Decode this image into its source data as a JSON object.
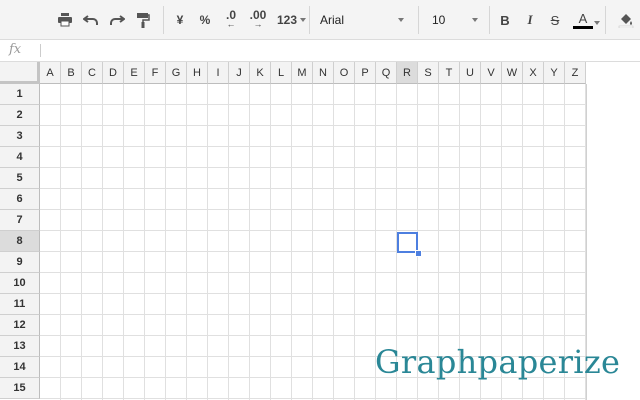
{
  "toolbar": {
    "font_name": "Arial",
    "font_size": "10",
    "currency_label": "¥",
    "percent_label": "%",
    "decrease_decimals_label": ".0",
    "increase_decimals_label": ".00",
    "more_formats_label": "123",
    "bold_label": "B",
    "italic_label": "I",
    "strike_label": "S",
    "text_color_label": "A"
  },
  "formula_bar": {
    "fx_label": "fx",
    "value": ""
  },
  "grid": {
    "columns": [
      "A",
      "B",
      "C",
      "D",
      "E",
      "F",
      "G",
      "H",
      "I",
      "J",
      "K",
      "L",
      "M",
      "N",
      "O",
      "P",
      "Q",
      "R",
      "S",
      "T",
      "U",
      "V",
      "W",
      "X",
      "Y",
      "Z"
    ],
    "rows": [
      "1",
      "2",
      "3",
      "4",
      "5",
      "6",
      "7",
      "8",
      "9",
      "10",
      "11",
      "12",
      "13",
      "14",
      "15"
    ],
    "selected_column": "R",
    "selected_row": "8"
  },
  "brand": {
    "text": "Graphpaperize"
  },
  "colors": {
    "selection": "#4d7fe0",
    "brand": "#2a8796",
    "text_color_swatch": "#000000"
  }
}
